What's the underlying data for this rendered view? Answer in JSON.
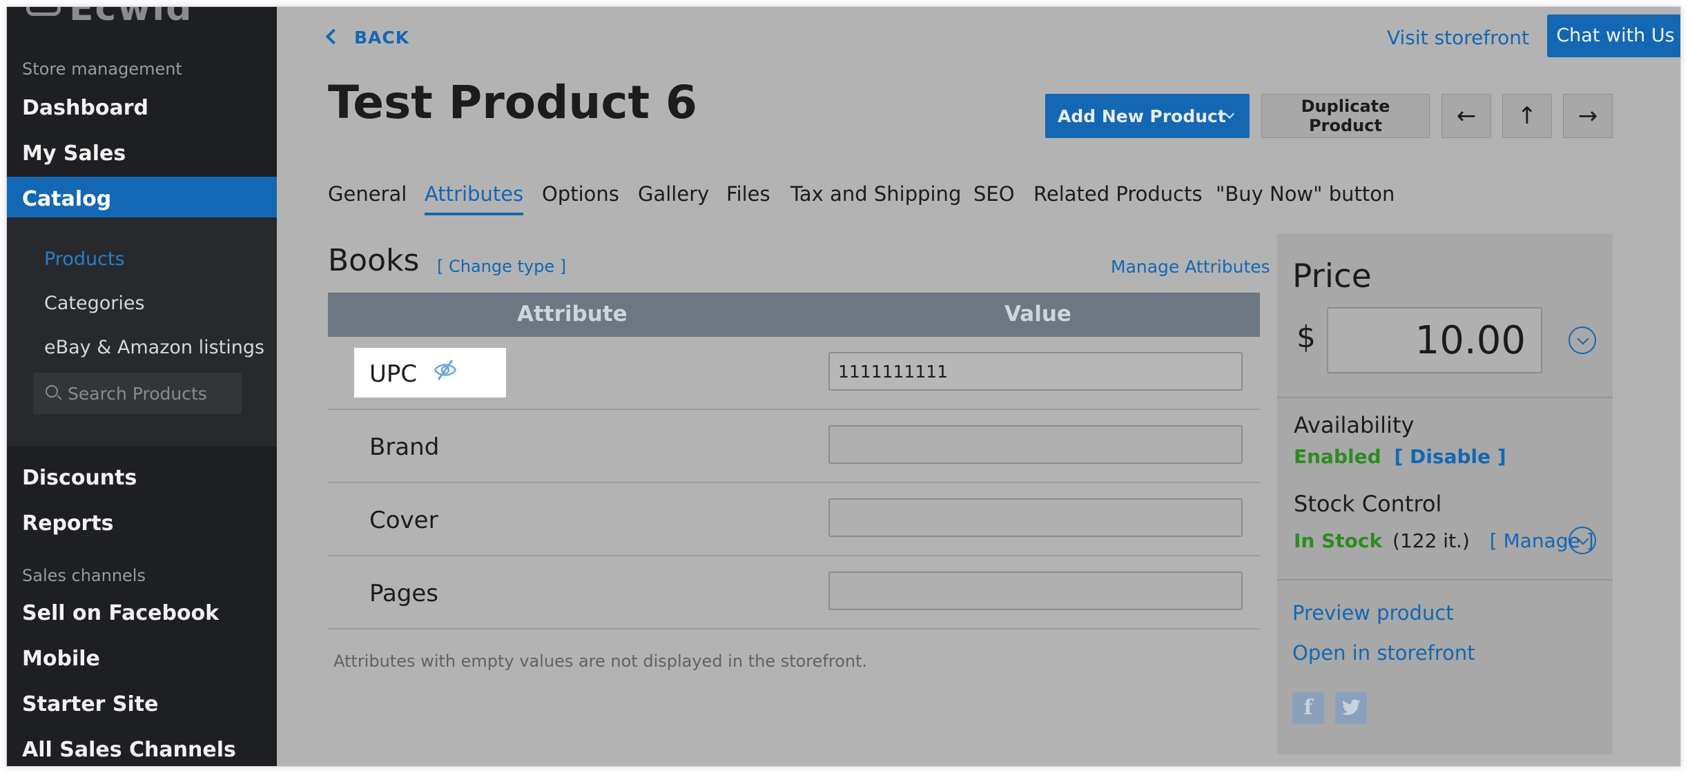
{
  "sidebar": {
    "logo": "Ecwid",
    "store_section": "Store management",
    "items": {
      "dashboard": "Dashboard",
      "my_sales": "My Sales",
      "catalog": "Catalog",
      "discounts": "Discounts",
      "reports": "Reports"
    },
    "catalog_sub": {
      "products": "Products",
      "categories": "Categories",
      "ebay_amazon": "eBay & Amazon listings"
    },
    "search_placeholder": "Search Products",
    "channels_section": "Sales channels",
    "channels": {
      "facebook": "Sell on Facebook",
      "mobile": "Mobile",
      "starter_site": "Starter Site",
      "all": "All Sales Channels"
    }
  },
  "header": {
    "back": "BACK",
    "visit_storefront": "Visit storefront",
    "chat": "Chat with Us"
  },
  "product": {
    "title": "Test Product 6",
    "add_new": "Add New Product",
    "duplicate": "Duplicate Product",
    "nav_prev": "←",
    "nav_up": "↑",
    "nav_next": "→"
  },
  "tabs": [
    {
      "label": "General"
    },
    {
      "label": "Attributes"
    },
    {
      "label": "Options"
    },
    {
      "label": "Gallery"
    },
    {
      "label": "Files"
    },
    {
      "label": "Tax and Shipping"
    },
    {
      "label": "SEO"
    },
    {
      "label": "Related Products"
    },
    {
      "label": "\"Buy Now\" button"
    }
  ],
  "active_tab": "Attributes",
  "attributes": {
    "type_name": "Books",
    "change_type": "[ Change type ]",
    "manage": "Manage Attributes",
    "col_attribute": "Attribute",
    "col_value": "Value",
    "rows": [
      {
        "label": "UPC",
        "value": "1111111111",
        "hidden_icon": "eye-off-icon"
      },
      {
        "label": "Brand",
        "value": ""
      },
      {
        "label": "Cover",
        "value": ""
      },
      {
        "label": "Pages",
        "value": ""
      }
    ],
    "note": "Attributes with empty values are not displayed in the storefront."
  },
  "price_panel": {
    "title": "Price",
    "currency": "$",
    "price": "10.00",
    "availability_label": "Availability",
    "availability_status": "Enabled",
    "availability_action": "[ Disable ]",
    "stock_label": "Stock Control",
    "stock_status": "In Stock",
    "stock_count": "(122 it.)",
    "stock_action": "[ Manage ]",
    "preview": "Preview product",
    "open_storefront": "Open in storefront",
    "social": [
      "facebook-icon",
      "twitter-icon"
    ]
  },
  "colors": {
    "accent": "#1467b3",
    "sidebar_bg": "#1e1f22",
    "status_green": "#2e8b22",
    "overlay": "#b3b3b3"
  }
}
